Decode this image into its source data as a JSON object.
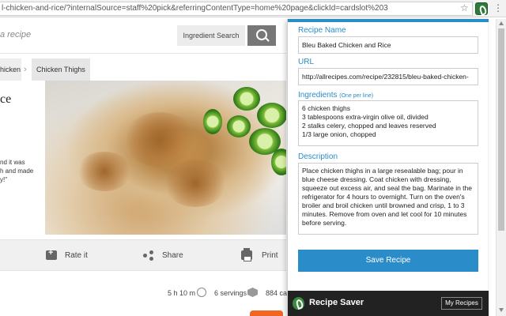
{
  "browser": {
    "url": "l-chicken-and-rice/?internalSource=staff%20pick&referringContentType=home%20page&clickId=cardslot%203"
  },
  "site": {
    "search_placeholder": "a recipe",
    "ingredient_search_label": "Ingredient Search",
    "breadcrumbs": [
      "hicken",
      "Chicken Thighs"
    ],
    "title_fragment": "ce",
    "quote_fragment": "nd it was\nh and made\ny!\""
  },
  "actions": {
    "rate_label": "Rate it",
    "share_label": "Share",
    "print_label": "Print"
  },
  "meta": {
    "time": "5 h 10 m",
    "servings": "6 servings",
    "calories": "884 cal"
  },
  "popup": {
    "name_label": "Recipe Name",
    "name_value": "Bleu Baked Chicken and Rice",
    "url_label": "URL",
    "url_value": "http://allrecipes.com/recipe/232815/bleu-baked-chicken-",
    "ingredients_label": "Ingredients",
    "ingredients_hint": "(One per line)",
    "ingredients_value": "6 chicken thighs\n3 tablespoons extra-virgin olive oil, divided\n2 stalks celery, chopped and leaves reserved\n1/3 large onion, chopped",
    "description_label": "Description",
    "description_value": "Place chicken thighs in a large resealable bag; pour in blue cheese dressing. Coat chicken with dressing, squeeze out excess air, and seal the bag. Marinate in the refrigerator for 4 hours to overnight. Turn on the oven's broiler and broil chicken until browned and crisp, 1 to 3 minutes. Remove from oven and let cool for 10 minutes before serving.",
    "save_label": "Save Recipe",
    "footer_title": "Recipe Saver",
    "my_recipes_label": "My Recipes"
  },
  "colors": {
    "accent": "#2a8cc9",
    "footer": "#222222",
    "cta_orange": "#f26522"
  }
}
